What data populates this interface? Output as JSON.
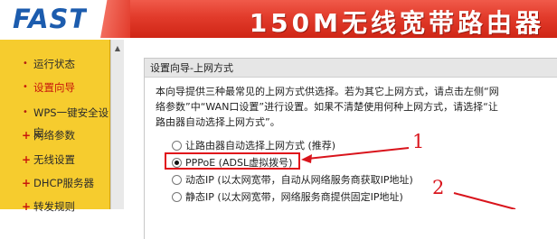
{
  "header": {
    "logo_text": "FAST",
    "product_title": "150M无线宽带路由器"
  },
  "sidebar": {
    "items": [
      {
        "label": "运行状态",
        "marker": "•",
        "active": false
      },
      {
        "label": "设置向导",
        "marker": "•",
        "active": true
      },
      {
        "label": "WPS一键安全设定",
        "marker": "•",
        "active": false
      },
      {
        "label": "网络参数",
        "marker": "+",
        "active": false
      },
      {
        "label": "无线设置",
        "marker": "+",
        "active": false
      },
      {
        "label": "DHCP服务器",
        "marker": "+",
        "active": false
      },
      {
        "label": "转发规则",
        "marker": "+",
        "active": false
      }
    ]
  },
  "panel": {
    "title": "设置向导-上网方式",
    "intro_line1": "本向导提供三种最常见的上网方式供选择。若为其它上网方式，请点击左侧“网",
    "intro_line2": "络参数”中“WAN口设置”进行设置。如果不清楚使用何种上网方式，请选择“让",
    "intro_line3": "路由器自动选择上网方式”。",
    "options": [
      {
        "label": "让路由器自动选择上网方式 (推荐)",
        "checked": false
      },
      {
        "label": "PPPoE (ADSL虚拟拨号)",
        "checked": true
      },
      {
        "label": "动态IP (以太网宽带，自动从网络服务商获取IP地址)",
        "checked": false
      },
      {
        "label": "静态IP (以太网宽带，网络服务商提供固定IP地址)",
        "checked": false
      }
    ]
  },
  "annotations": {
    "number_1": "1",
    "number_2": "2",
    "color": "#d9141c"
  },
  "colors": {
    "header_red": "#e23b2b",
    "logo_blue": "#1c5cae",
    "sidebar_yellow": "#f6cc2e",
    "active_nav": "#c8170b"
  }
}
